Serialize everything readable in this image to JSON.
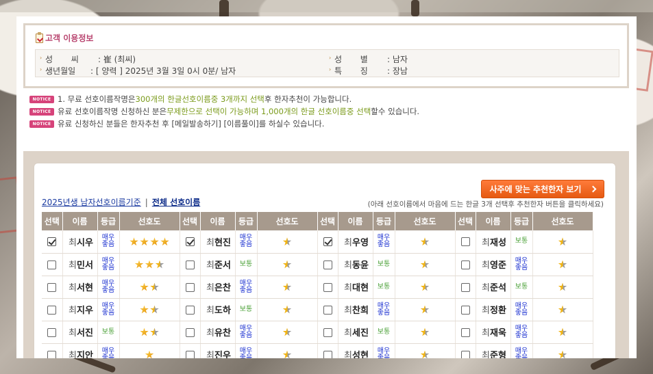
{
  "customer_info": {
    "title": "고객 이용정보",
    "fields": [
      {
        "label": "성       씨",
        "value": ": 崔 (최씨)"
      },
      {
        "label": "성       별",
        "value": ": 남자"
      },
      {
        "label": "생년월일",
        "value": ": [ 양력 ] 2025년 3월 3일 0시 0분/ 남자"
      },
      {
        "label": "특       징",
        "value": ": 장남"
      }
    ]
  },
  "notices": {
    "badge": "NOTICE",
    "items": [
      {
        "parts": [
          "1. 무료 선호이름작명은 ",
          "300개의 한글선호이름중 3개까지 선택",
          "후 한자추천이 가능합니다."
        ]
      },
      {
        "parts": [
          "유료 선호이름작명 신청하신 분은",
          "무제한으로 선택이 가능하며 1,000개의 한글 선호이름중 선택",
          "할수 있습니다."
        ]
      },
      {
        "parts": [
          "유료 신청하신 분들은 한자추천 후 [메일발송하기] [이름풀이]를 하실수 있습니다.",
          "",
          ""
        ]
      }
    ]
  },
  "recommend_button": "사주에 맞는 추천한자 보기",
  "links": {
    "by_year": "2025년생 남자선호이름기준",
    "sep": "|",
    "all": "전체 선호이름"
  },
  "help_text": "(아래 선호이름에서 마음에 드는 한글 3개 선택후 추천한자 버튼을 클릭하세요)",
  "table": {
    "headers": [
      "선택",
      "이름",
      "등급",
      "선호도"
    ],
    "surname": "최",
    "grade_labels": {
      "great": "매우\n좋음",
      "normal": "보통"
    },
    "rows": [
      [
        {
          "name": "시우",
          "checked": true,
          "grade": "great",
          "stars": 4
        },
        {
          "name": "현진",
          "checked": true,
          "grade": "great",
          "stars": 0.5
        },
        {
          "name": "우영",
          "checked": true,
          "grade": "great",
          "stars": 0.5
        },
        {
          "name": "재성",
          "checked": false,
          "grade": "normal",
          "stars": 0.5
        }
      ],
      [
        {
          "name": "민서",
          "checked": false,
          "grade": "great",
          "stars": 2.5
        },
        {
          "name": "준서",
          "checked": false,
          "grade": "normal",
          "stars": 0.5
        },
        {
          "name": "동윤",
          "checked": false,
          "grade": "normal",
          "stars": 0.5
        },
        {
          "name": "영준",
          "checked": false,
          "grade": "great",
          "stars": 0.5
        }
      ],
      [
        {
          "name": "서현",
          "checked": false,
          "grade": "great",
          "stars": 1.5
        },
        {
          "name": "은찬",
          "checked": false,
          "grade": "great",
          "stars": 0.5
        },
        {
          "name": "대현",
          "checked": false,
          "grade": "normal",
          "stars": 0.5
        },
        {
          "name": "준석",
          "checked": false,
          "grade": "normal",
          "stars": 0.5
        }
      ],
      [
        {
          "name": "지우",
          "checked": false,
          "grade": "great",
          "stars": 1.5
        },
        {
          "name": "도하",
          "checked": false,
          "grade": "normal",
          "stars": 0.5
        },
        {
          "name": "찬희",
          "checked": false,
          "grade": "great",
          "stars": 0.5
        },
        {
          "name": "정환",
          "checked": false,
          "grade": "great",
          "stars": 0.5
        }
      ],
      [
        {
          "name": "서진",
          "checked": false,
          "grade": "normal",
          "stars": 1.5
        },
        {
          "name": "유찬",
          "checked": false,
          "grade": "great",
          "stars": 0.5
        },
        {
          "name": "세진",
          "checked": false,
          "grade": "normal",
          "stars": 0.5
        },
        {
          "name": "재욱",
          "checked": false,
          "grade": "great",
          "stars": 0.5
        }
      ],
      [
        {
          "name": "지안",
          "checked": false,
          "grade": "great",
          "stars": 1
        },
        {
          "name": "진우",
          "checked": false,
          "grade": "great",
          "stars": 0.5
        },
        {
          "name": "성현",
          "checked": false,
          "grade": "great",
          "stars": 0.5
        },
        {
          "name": "준형",
          "checked": false,
          "grade": "great",
          "stars": 0.5
        }
      ]
    ]
  },
  "colors": {
    "accent_pink": "#d6437a",
    "button_orange": "#f06a22",
    "header_brown": "#a79a8d",
    "grade_blue": "#1a2fd0",
    "grade_green": "#4aa036"
  }
}
